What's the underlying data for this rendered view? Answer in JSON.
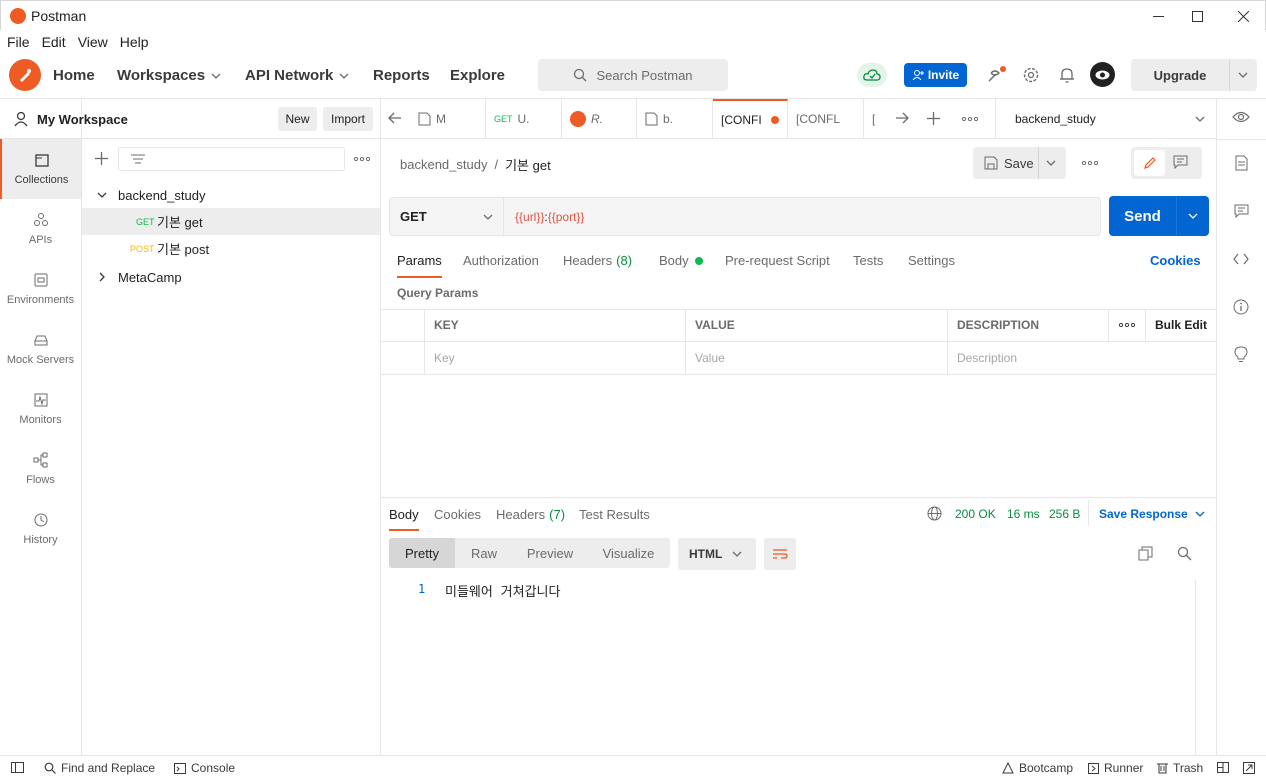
{
  "window": {
    "title": "Postman"
  },
  "menu": [
    "File",
    "Edit",
    "View",
    "Help"
  ],
  "header": {
    "nav": {
      "home": "Home",
      "workspaces": "Workspaces",
      "api_network": "API Network",
      "reports": "Reports",
      "explore": "Explore"
    },
    "search_placeholder": "Search Postman",
    "invite": "Invite",
    "upgrade": "Upgrade"
  },
  "rail": {
    "collections": "Collections",
    "apis": "APIs",
    "environments": "Environments",
    "mock_servers": "Mock Servers",
    "monitors": "Monitors",
    "flows": "Flows",
    "history": "History"
  },
  "sidebar": {
    "workspace": "My Workspace",
    "new": "New",
    "import": "Import",
    "tree": {
      "folder1": "backend_study",
      "req1_method": "GET",
      "req1_name": "기본 get",
      "req2_method": "POST",
      "req2_name": "기본 post",
      "folder2": "MetaCamp"
    }
  },
  "tabs": {
    "t1": "M",
    "t2_method": "GET",
    "t2": "U.",
    "t3": "R.",
    "t4": "b.",
    "t5": "[CONFI",
    "t6": "[CONFL",
    "t7": "[",
    "environment": "backend_study"
  },
  "request": {
    "breadcrumb_parent": "backend_study",
    "breadcrumb_sep": "/",
    "breadcrumb_name": "기본 get",
    "save": "Save",
    "method": "GET",
    "url_part1": "{{url}}",
    "url_colon": ":",
    "url_part2": "{{port}}",
    "send": "Send",
    "tabs": {
      "params": "Params",
      "authorization": "Authorization",
      "headers": "Headers",
      "headers_count": "(8)",
      "body": "Body",
      "prerequest": "Pre-request Script",
      "tests": "Tests",
      "settings": "Settings",
      "cookies": "Cookies"
    },
    "query_params_title": "Query Params",
    "table": {
      "key": "KEY",
      "value": "VALUE",
      "description": "DESCRIPTION",
      "bulk_edit": "Bulk Edit",
      "key_placeholder": "Key",
      "value_placeholder": "Value",
      "description_placeholder": "Description"
    }
  },
  "response": {
    "tabs": {
      "body": "Body",
      "cookies": "Cookies",
      "headers": "Headers",
      "headers_count": "(7)",
      "test_results": "Test Results"
    },
    "status": "200 OK",
    "time": "16 ms",
    "size": "256 B",
    "save_response": "Save Response",
    "views": {
      "pretty": "Pretty",
      "raw": "Raw",
      "preview": "Preview",
      "visualize": "Visualize"
    },
    "format": "HTML",
    "line_number": "1",
    "body_text": "미들웨어 거쳐갑니다"
  },
  "footer": {
    "find_replace": "Find and Replace",
    "console": "Console",
    "bootcamp": "Bootcamp",
    "runner": "Runner",
    "trash": "Trash"
  },
  "colors": {
    "accent": "#ef5b25",
    "primary": "#0265d2",
    "get": "#0cbb52",
    "post": "#ffb400",
    "status_ok": "#0b8a3e",
    "variable": "#e05243"
  }
}
